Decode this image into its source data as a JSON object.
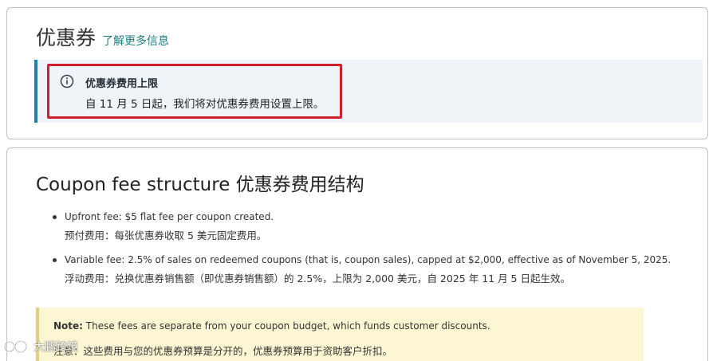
{
  "header": {
    "title": "优惠券",
    "learn_more": "了解更多信息"
  },
  "alert": {
    "icon": "info-icon",
    "title": "优惠券费用上限",
    "body": "自 11 月 5 日起，我们将对优惠券费用设置上限。",
    "accent_color": "#1c7fb8",
    "highlight_color": "#cf1f2c"
  },
  "fee_section": {
    "title": "Coupon fee structure  优惠券费用结构",
    "items": [
      {
        "en": "Upfront fee: $5 flat fee per coupon created.",
        "cn": "预付费用：每张优惠券收取 5 美元固定费用。"
      },
      {
        "en": "Variable fee: 2.5% of sales on redeemed coupons (that is, coupon sales), capped at $2,000, effective as of November 5, 2025.",
        "cn": "浮动费用：兑换优惠券销售额（即优惠券销售额）的 2.5%，上限为 2,000 美元，自 2025 年 11 月 5 日起生效。"
      }
    ]
  },
  "note": {
    "label": "Note:",
    "en": " These fees are separate from your coupon budget, which funds customer discounts.",
    "cn": "注意：这些费用与您的优惠券预算是分开的，优惠券预算用于资助客户折扣。",
    "background": "#fdf6d3"
  },
  "watermark": {
    "text": "大鹏跨境"
  }
}
